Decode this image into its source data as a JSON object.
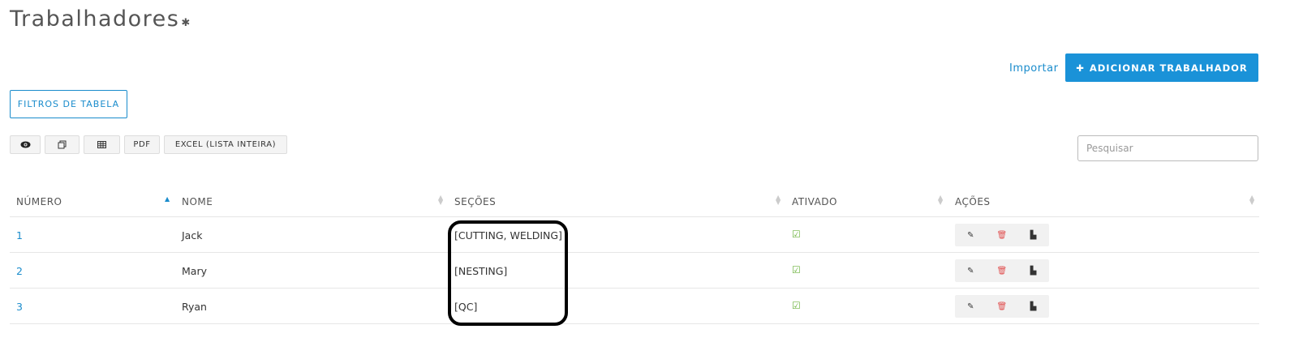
{
  "page": {
    "title": "Trabalhadores",
    "settings_icon": "gear-icon"
  },
  "header_actions": {
    "import_label": "Importar",
    "add_label": "ADICIONAR TRABALHADOR",
    "add_icon": "plus-icon"
  },
  "filters": {
    "label": "FILTROS DE TABELA"
  },
  "toolbar": {
    "view_icon": "eye-icon",
    "copy_icon": "copy-icon",
    "csv_icon": "table-icon",
    "pdf_label": "PDF",
    "excel_label": "EXCEL (LISTA INTEIRA)"
  },
  "search": {
    "placeholder": "Pesquisar"
  },
  "table": {
    "columns": [
      "NÚMERO",
      "NOME",
      "SEÇÕES",
      "ATIVADO",
      "AÇÕES"
    ],
    "rows": [
      {
        "numero": "1",
        "nome": "Jack",
        "secoes": "[CUTTING, WELDING]",
        "ativado": true
      },
      {
        "numero": "2",
        "nome": "Mary",
        "secoes": "[NESTING]",
        "ativado": true
      },
      {
        "numero": "3",
        "nome": "Ryan",
        "secoes": "[QC]",
        "ativado": true
      }
    ]
  },
  "colors": {
    "accent": "#1a92d8",
    "link": "#1a8ccc",
    "active_check": "#6cb33e",
    "delete": "#e05050"
  }
}
